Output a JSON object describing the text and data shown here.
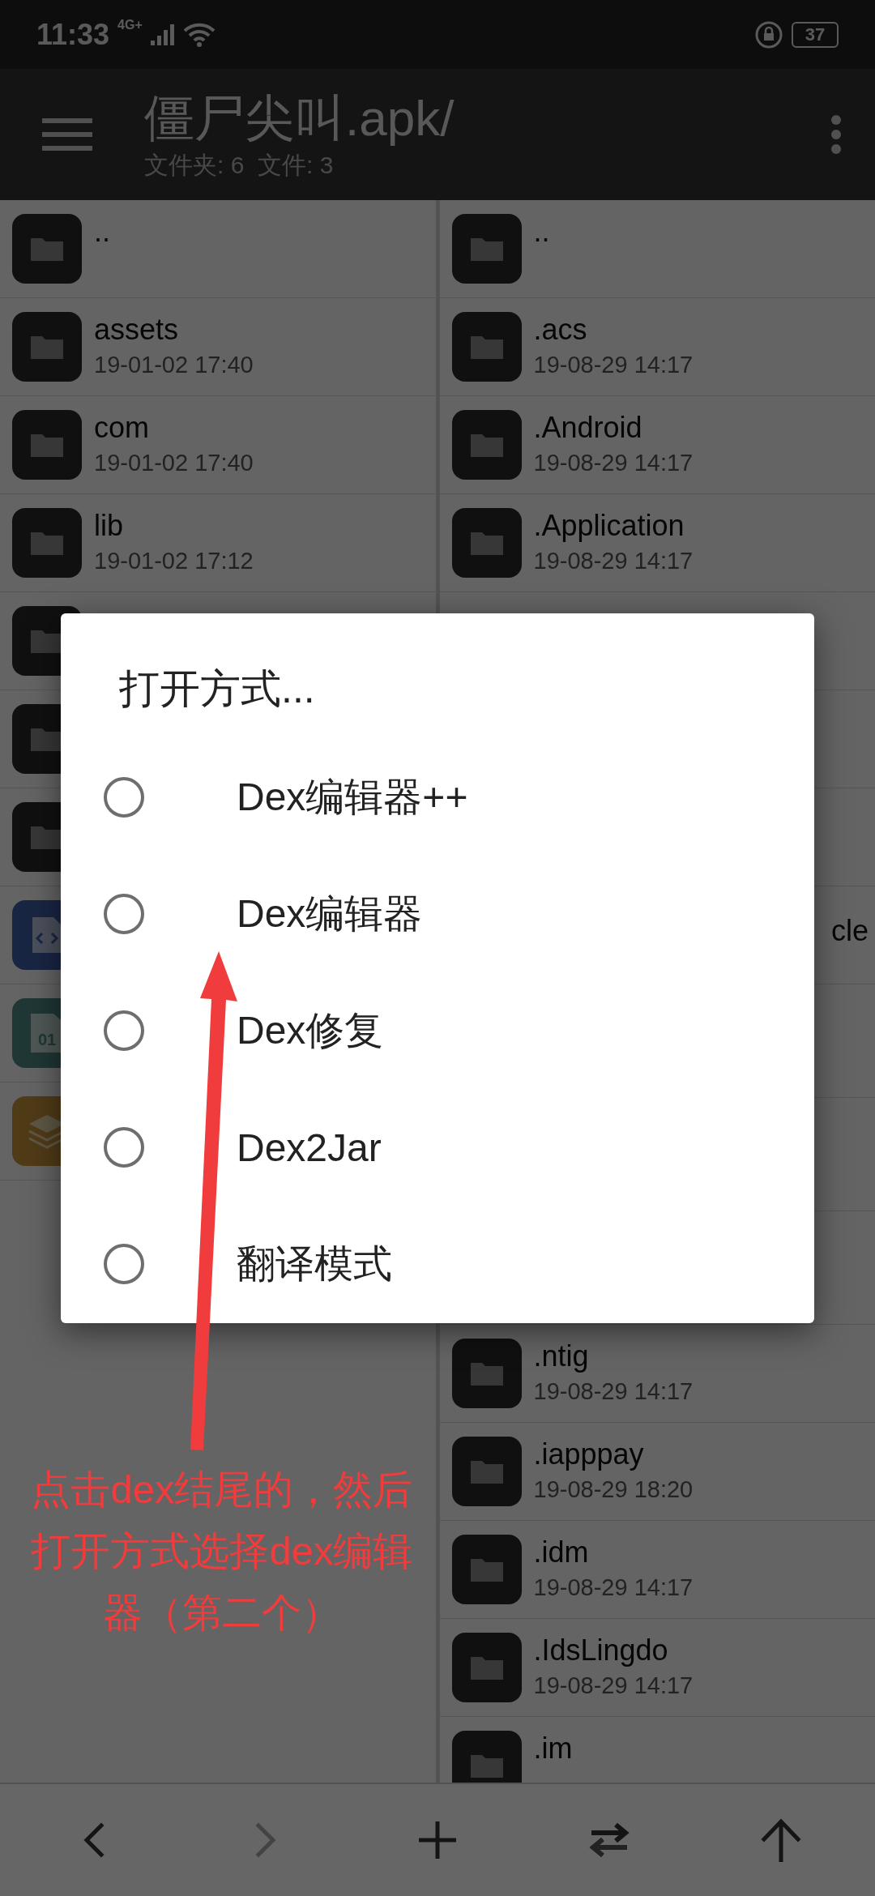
{
  "status_bar": {
    "time": "11:33",
    "network": "4G+",
    "battery": "37"
  },
  "toolbar": {
    "title": "僵尸尖叫.apk/",
    "subtitle": "文件夹: 6  文件: 3"
  },
  "left_pane": {
    "rows": [
      {
        "kind": "folder",
        "name": ".."
      },
      {
        "kind": "folder",
        "name": "assets",
        "date": "19-01-02 17:40"
      },
      {
        "kind": "folder",
        "name": "com",
        "date": "19-01-02 17:40"
      },
      {
        "kind": "folder",
        "name": "lib",
        "date": "19-01-02 17:12"
      },
      {
        "kind": "folder"
      },
      {
        "kind": "folder"
      },
      {
        "kind": "folder"
      },
      {
        "kind": "code"
      },
      {
        "kind": "binary",
        "icon_text": "01"
      },
      {
        "kind": "layers"
      }
    ]
  },
  "right_pane": {
    "rows": [
      {
        "kind": "folder",
        "name": ".."
      },
      {
        "kind": "folder",
        "name": ".acs",
        "date": "19-08-29 14:17"
      },
      {
        "kind": "folder",
        "name": ".Android",
        "date": "19-08-29 14:17"
      },
      {
        "kind": "folder",
        "name": ".Application",
        "date": "19-08-29 14:17"
      },
      {
        "kind": "hidden"
      },
      {
        "kind": "hidden"
      },
      {
        "kind": "hidden"
      },
      {
        "kind": "hidden",
        "name_tail": "cle"
      },
      {
        "kind": "hidden"
      },
      {
        "kind": "hidden"
      },
      {
        "kind": "hidden"
      },
      {
        "kind": "folder",
        "name": ".ntig",
        "date": "19-08-29 14:17"
      },
      {
        "kind": "folder",
        "name": ".iapppay",
        "date": "19-08-29 18:20"
      },
      {
        "kind": "folder",
        "name": ".idm",
        "date": "19-08-29 14:17"
      },
      {
        "kind": "folder",
        "name": ".IdsLingdo",
        "date": "19-08-29 14:17"
      },
      {
        "kind": "folder",
        "name": ".im"
      }
    ]
  },
  "bottom_bar": [
    {
      "kind": "back",
      "disabled": false
    },
    {
      "kind": "forward",
      "disabled": true
    },
    {
      "kind": "add",
      "disabled": false
    },
    {
      "kind": "swap",
      "disabled": false
    },
    {
      "kind": "up",
      "disabled": false
    }
  ],
  "dialog": {
    "title": "打开方式...",
    "options": [
      {
        "label": "Dex编辑器++",
        "selected": false
      },
      {
        "label": "Dex编辑器",
        "selected": false
      },
      {
        "label": "Dex修复",
        "selected": false
      },
      {
        "label": "Dex2Jar",
        "selected": false
      },
      {
        "label": "翻译模式",
        "selected": false
      }
    ]
  },
  "annotation": {
    "lines": [
      "点击dex结尾的，然后",
      "打开方式选择dex编辑",
      "器（第二个）"
    ]
  }
}
